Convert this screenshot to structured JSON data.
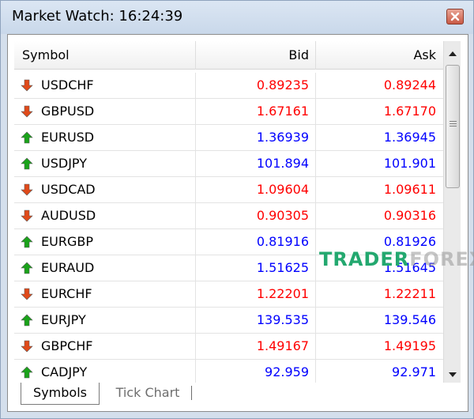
{
  "window": {
    "title": "Market Watch: 16:24:39",
    "close_icon": "close-icon"
  },
  "columns": {
    "symbol": "Symbol",
    "bid": "Bid",
    "ask": "Ask"
  },
  "colors": {
    "up": "#0000ff",
    "down": "#ff0000",
    "up_arrow": "#1aa31a",
    "down_arrow": "#e04a1a"
  },
  "rows": [
    {
      "symbol": "USDCHF",
      "bid": "0.89235",
      "ask": "0.89244",
      "direction": "down"
    },
    {
      "symbol": "GBPUSD",
      "bid": "1.67161",
      "ask": "1.67170",
      "direction": "down"
    },
    {
      "symbol": "EURUSD",
      "bid": "1.36939",
      "ask": "1.36945",
      "direction": "up"
    },
    {
      "symbol": "USDJPY",
      "bid": "101.894",
      "ask": "101.901",
      "direction": "up"
    },
    {
      "symbol": "USDCAD",
      "bid": "1.09604",
      "ask": "1.09611",
      "direction": "down"
    },
    {
      "symbol": "AUDUSD",
      "bid": "0.90305",
      "ask": "0.90316",
      "direction": "down"
    },
    {
      "symbol": "EURGBP",
      "bid": "0.81916",
      "ask": "0.81926",
      "direction": "up"
    },
    {
      "symbol": "EURAUD",
      "bid": "1.51625",
      "ask": "1.51645",
      "direction": "up"
    },
    {
      "symbol": "EURCHF",
      "bid": "1.22201",
      "ask": "1.22211",
      "direction": "down"
    },
    {
      "symbol": "EURJPY",
      "bid": "139.535",
      "ask": "139.546",
      "direction": "up"
    },
    {
      "symbol": "GBPCHF",
      "bid": "1.49167",
      "ask": "1.49195",
      "direction": "down"
    },
    {
      "symbol": "CADJPY",
      "bid": "92.959",
      "ask": "92.971",
      "direction": "up"
    }
  ],
  "tabs": [
    {
      "label": "Symbols",
      "active": true
    },
    {
      "label": "Tick Chart",
      "active": false
    }
  ],
  "watermark": {
    "part1": "TRADER",
    "part2": "FOREX"
  }
}
